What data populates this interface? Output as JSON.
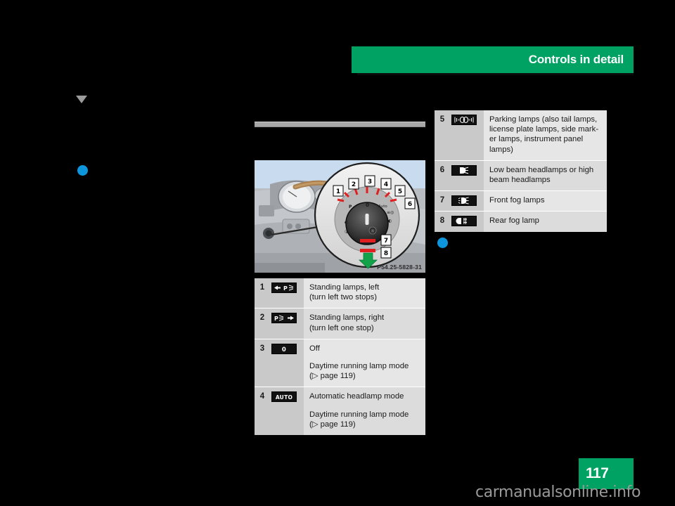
{
  "header": {
    "title": "Controls in detail",
    "band_color": "#00a263"
  },
  "page": {
    "number": "117",
    "badge_color": "#00a263"
  },
  "watermark": {
    "text": "carmanualsonline.info"
  },
  "markers": {
    "triangle_color": "#9b9b9b",
    "bullet_color": "#0d96dd"
  },
  "figure": {
    "photo_id": "P54.25-5828-31",
    "callouts": [
      "1",
      "2",
      "3",
      "4",
      "5",
      "6",
      "7",
      "8"
    ],
    "switch_labels": [
      "P",
      "0",
      "Auto"
    ]
  },
  "tables": {
    "left": [
      {
        "num": "1",
        "icon": "standing-lamps-left-icon",
        "lines": [
          "Standing lamps, left",
          "(turn left two stops)"
        ]
      },
      {
        "num": "2",
        "icon": "standing-lamps-right-icon",
        "lines": [
          "Standing lamps, right",
          "(turn left one stop)"
        ]
      },
      {
        "num": "3",
        "icon": "off-position-icon",
        "lines": [
          "Off"
        ],
        "extra": [
          "Daytime running lamp mode",
          "(▷ page 119)"
        ]
      },
      {
        "num": "4",
        "icon": "auto-headlamp-icon",
        "lines": [
          "Automatic headlamp mode"
        ],
        "extra": [
          "Daytime running lamp mode",
          "(▷ page 119)"
        ]
      }
    ],
    "right": [
      {
        "num": "5",
        "icon": "parking-lamps-icon",
        "lines": [
          "Parking lamps (also tail lamps,",
          "license plate lamps, side mark-",
          "er lamps, instrument panel",
          "lamps)"
        ]
      },
      {
        "num": "6",
        "icon": "low-beam-headlamps-icon",
        "lines": [
          "Low beam headlamps or high",
          "beam headlamps"
        ]
      },
      {
        "num": "7",
        "icon": "front-fog-lamps-icon",
        "lines": [
          "Front fog lamps"
        ]
      },
      {
        "num": "8",
        "icon": "rear-fog-lamp-icon",
        "lines": [
          "Rear fog lamp"
        ]
      }
    ]
  }
}
